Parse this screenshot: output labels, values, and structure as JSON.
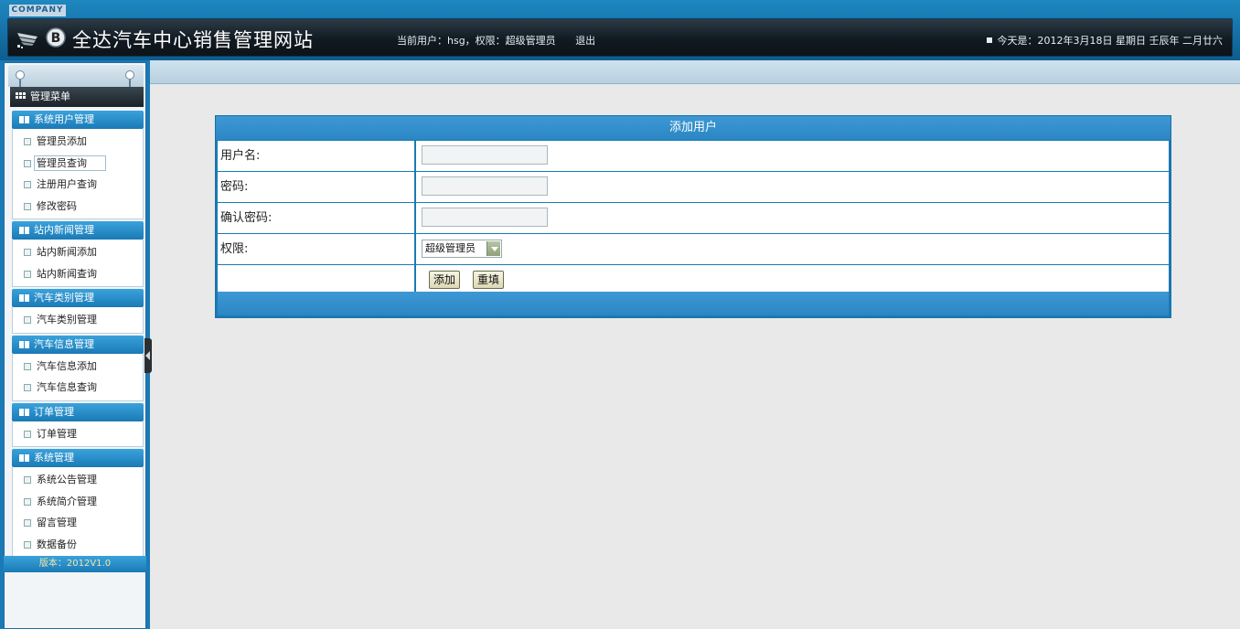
{
  "header": {
    "company_tag": "COMPANY",
    "site_title": "全达汽车中心销售管理网站",
    "current_user_label": "当前用户：hsg，权限：超级管理员",
    "logout": "退出",
    "date_text": "今天是：2012年3月18日 星期日 壬辰年 二月廿六"
  },
  "sidebar": {
    "menu_title": "管理菜单",
    "groups": [
      {
        "title": "系统用户管理",
        "items": [
          "管理员添加",
          "管理员查询",
          "注册用户查询",
          "修改密码"
        ]
      },
      {
        "title": "站内新闻管理",
        "items": [
          "站内新闻添加",
          "站内新闻查询"
        ]
      },
      {
        "title": "汽车类别管理",
        "items": [
          "汽车类别管理"
        ]
      },
      {
        "title": "汽车信息管理",
        "items": [
          "汽车信息添加",
          "汽车信息查询"
        ]
      },
      {
        "title": "订单管理",
        "items": [
          "订单管理"
        ]
      },
      {
        "title": "系统管理",
        "items": [
          "系统公告管理",
          "系统简介管理",
          "留言管理",
          "数据备份"
        ]
      }
    ],
    "version": "版本：2012V1.0"
  },
  "form": {
    "title": "添加用户",
    "username_label": "用户名:",
    "password_label": "密码:",
    "confirm_label": "确认密码:",
    "role_label": "权限:",
    "role_selected": "超级管理员",
    "username_value": "",
    "password_value": "",
    "confirm_value": "",
    "add_button": "添加",
    "reset_button": "重填"
  },
  "colors": {
    "accent_blue": "#1a7ab5",
    "header_dark": "#111a22"
  }
}
